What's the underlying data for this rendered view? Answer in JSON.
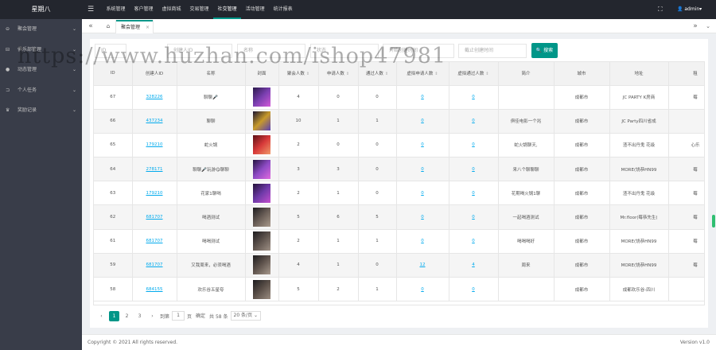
{
  "app": {
    "logo": "星期八",
    "menu_toggle": "☰",
    "fullscreen": "⛶",
    "user": "👤 admin▾"
  },
  "nav": [
    "系统管理",
    "客户管理",
    "虚拟商城",
    "交易管理",
    "社交管理",
    "活动管理",
    "统计报表"
  ],
  "nav_active": 4,
  "sidebar": [
    {
      "icon": "⊖",
      "label": "聚会管理",
      "arrow": "⌄"
    },
    {
      "icon": "⊟",
      "label": "俱乐部管理",
      "arrow": "⌄"
    },
    {
      "icon": "●",
      "label": "动态管理",
      "arrow": "⌄"
    },
    {
      "icon": "⊐",
      "label": "个人任务",
      "arrow": "⌄"
    },
    {
      "icon": "♛",
      "label": "奖励记录",
      "arrow": "⌄"
    }
  ],
  "tabs": {
    "prev": "«",
    "home": "⌂",
    "active": "聚会管理",
    "close": "×",
    "next": "»",
    "menu": "⌄"
  },
  "filters": [
    {
      "label": "ID",
      "value": ""
    },
    {
      "label": "创建人ID",
      "value": ""
    },
    {
      "label": "名称",
      "value": ""
    },
    {
      "label": "状态",
      "value": ""
    },
    {
      "label": "",
      "value": "开始创建时间"
    },
    {
      "label": "",
      "value": "截止创建时间"
    }
  ],
  "search_button": "🔍 搜索",
  "table": {
    "columns": [
      "ID",
      "创建人ID",
      "名称",
      "封面",
      "聚会人数",
      "申请人数",
      "通过人数",
      "虚拟申请人数",
      "虚拟通过人数",
      "简介",
      "城市",
      "地址",
      "租"
    ],
    "sortable": [
      false,
      false,
      false,
      false,
      true,
      true,
      true,
      true,
      true,
      false,
      false,
      false,
      false
    ],
    "rows": [
      [
        "67",
        "328226",
        "聊聊🎤",
        "",
        "4",
        "0",
        "0",
        "0",
        "0",
        "",
        "成都市",
        "JC PARTY K房商",
        "莓"
      ],
      [
        "66",
        "437234",
        "聊聊",
        "",
        "10",
        "1",
        "1",
        "0",
        "0",
        "俱佳电影一个兆",
        "成都市",
        "JC Party四川省成",
        ""
      ],
      [
        "65",
        "179210",
        "蛇火锅",
        "",
        "2",
        "0",
        "0",
        "0",
        "0",
        "蛇火锅聊天,",
        "成都市",
        "渣不出丹鬼 花级",
        "心乐"
      ],
      [
        "64",
        "278171",
        "聊聊🎤玩游😋聊聊",
        "",
        "3",
        "3",
        "0",
        "0",
        "0",
        "来八个聊聊聊",
        "成都市",
        "MORE(饶恭HN99",
        "莓"
      ],
      [
        "63",
        "179210",
        "花家1聊喝",
        "",
        "2",
        "1",
        "0",
        "0",
        "0",
        "花期喝火锅1聊",
        "成都市",
        "渣不出丹鬼 花级",
        "莓"
      ],
      [
        "62",
        "681707",
        "喝酒测试",
        "",
        "5",
        "6",
        "5",
        "0",
        "0",
        "一起喝酒测试",
        "成都市",
        "Mr.floor(莓恭先生(",
        "莓"
      ],
      [
        "61",
        "681707",
        "喝喝测试",
        "",
        "2",
        "1",
        "1",
        "0",
        "0",
        "喝喝喝好",
        "成都市",
        "MORE(饶恭HN99",
        "莓"
      ],
      [
        "59",
        "681707",
        "又我周来，必须喝酒",
        "",
        "4",
        "1",
        "0",
        "12",
        "4",
        "周来",
        "成都市",
        "MORE(饶恭HN99",
        "莓"
      ],
      [
        "58",
        "684155",
        "欢乐谷五星夸",
        "",
        "5",
        "2",
        "1",
        "0",
        "0",
        "",
        "成都市",
        "成都欢乐谷-四川",
        ""
      ]
    ]
  },
  "covers": [
    {
      "name": "purple-stage",
      "colors": [
        "#2a1a4a",
        "#7a3fb0",
        "#d35ad9"
      ]
    },
    {
      "name": "gold-stage",
      "colors": [
        "#1b1530",
        "#c79a2a",
        "#5a3fb5"
      ]
    },
    {
      "name": "red-neon",
      "colors": [
        "#5a0f14",
        "#d83a3a",
        "#f09a6a"
      ]
    },
    {
      "name": "purple-stage",
      "colors": [
        "#241440",
        "#8c4ac4",
        "#e06adf"
      ]
    },
    {
      "name": "purple-stage",
      "colors": [
        "#221238",
        "#6e3aa8",
        "#c44fcf"
      ]
    },
    {
      "name": "dark-bar",
      "colors": [
        "#1c1b1e",
        "#6a5e57",
        "#a99a8c"
      ]
    },
    {
      "name": "dark-bar",
      "colors": [
        "#1c1b1e",
        "#5f544e",
        "#9f9186"
      ]
    },
    {
      "name": "dark-bar",
      "colors": [
        "#1c1b1e",
        "#62564f",
        "#a89a8e"
      ]
    },
    {
      "name": "dark-bar",
      "colors": [
        "#1c1b1e",
        "#5c514a",
        "#9a8c80"
      ]
    }
  ],
  "pager": {
    "prev": "‹",
    "pages": [
      "1",
      "2",
      "3"
    ],
    "current": "1",
    "next": "›",
    "goto_label": "到第",
    "goto_value": "1",
    "unit": "页",
    "confirm": "确定",
    "total": "共 58 条",
    "size": "20 条/页 ⌄"
  },
  "footer": {
    "copyright": "Copyright © 2021 All rights reserved.",
    "version": "Version v1.0"
  },
  "watermark": "https://www.huzhan.com/ishop47981",
  "colors": {
    "accent": "#009688",
    "link": "#01AAED",
    "topbar": "#23262e",
    "sidebar": "#393d49"
  }
}
